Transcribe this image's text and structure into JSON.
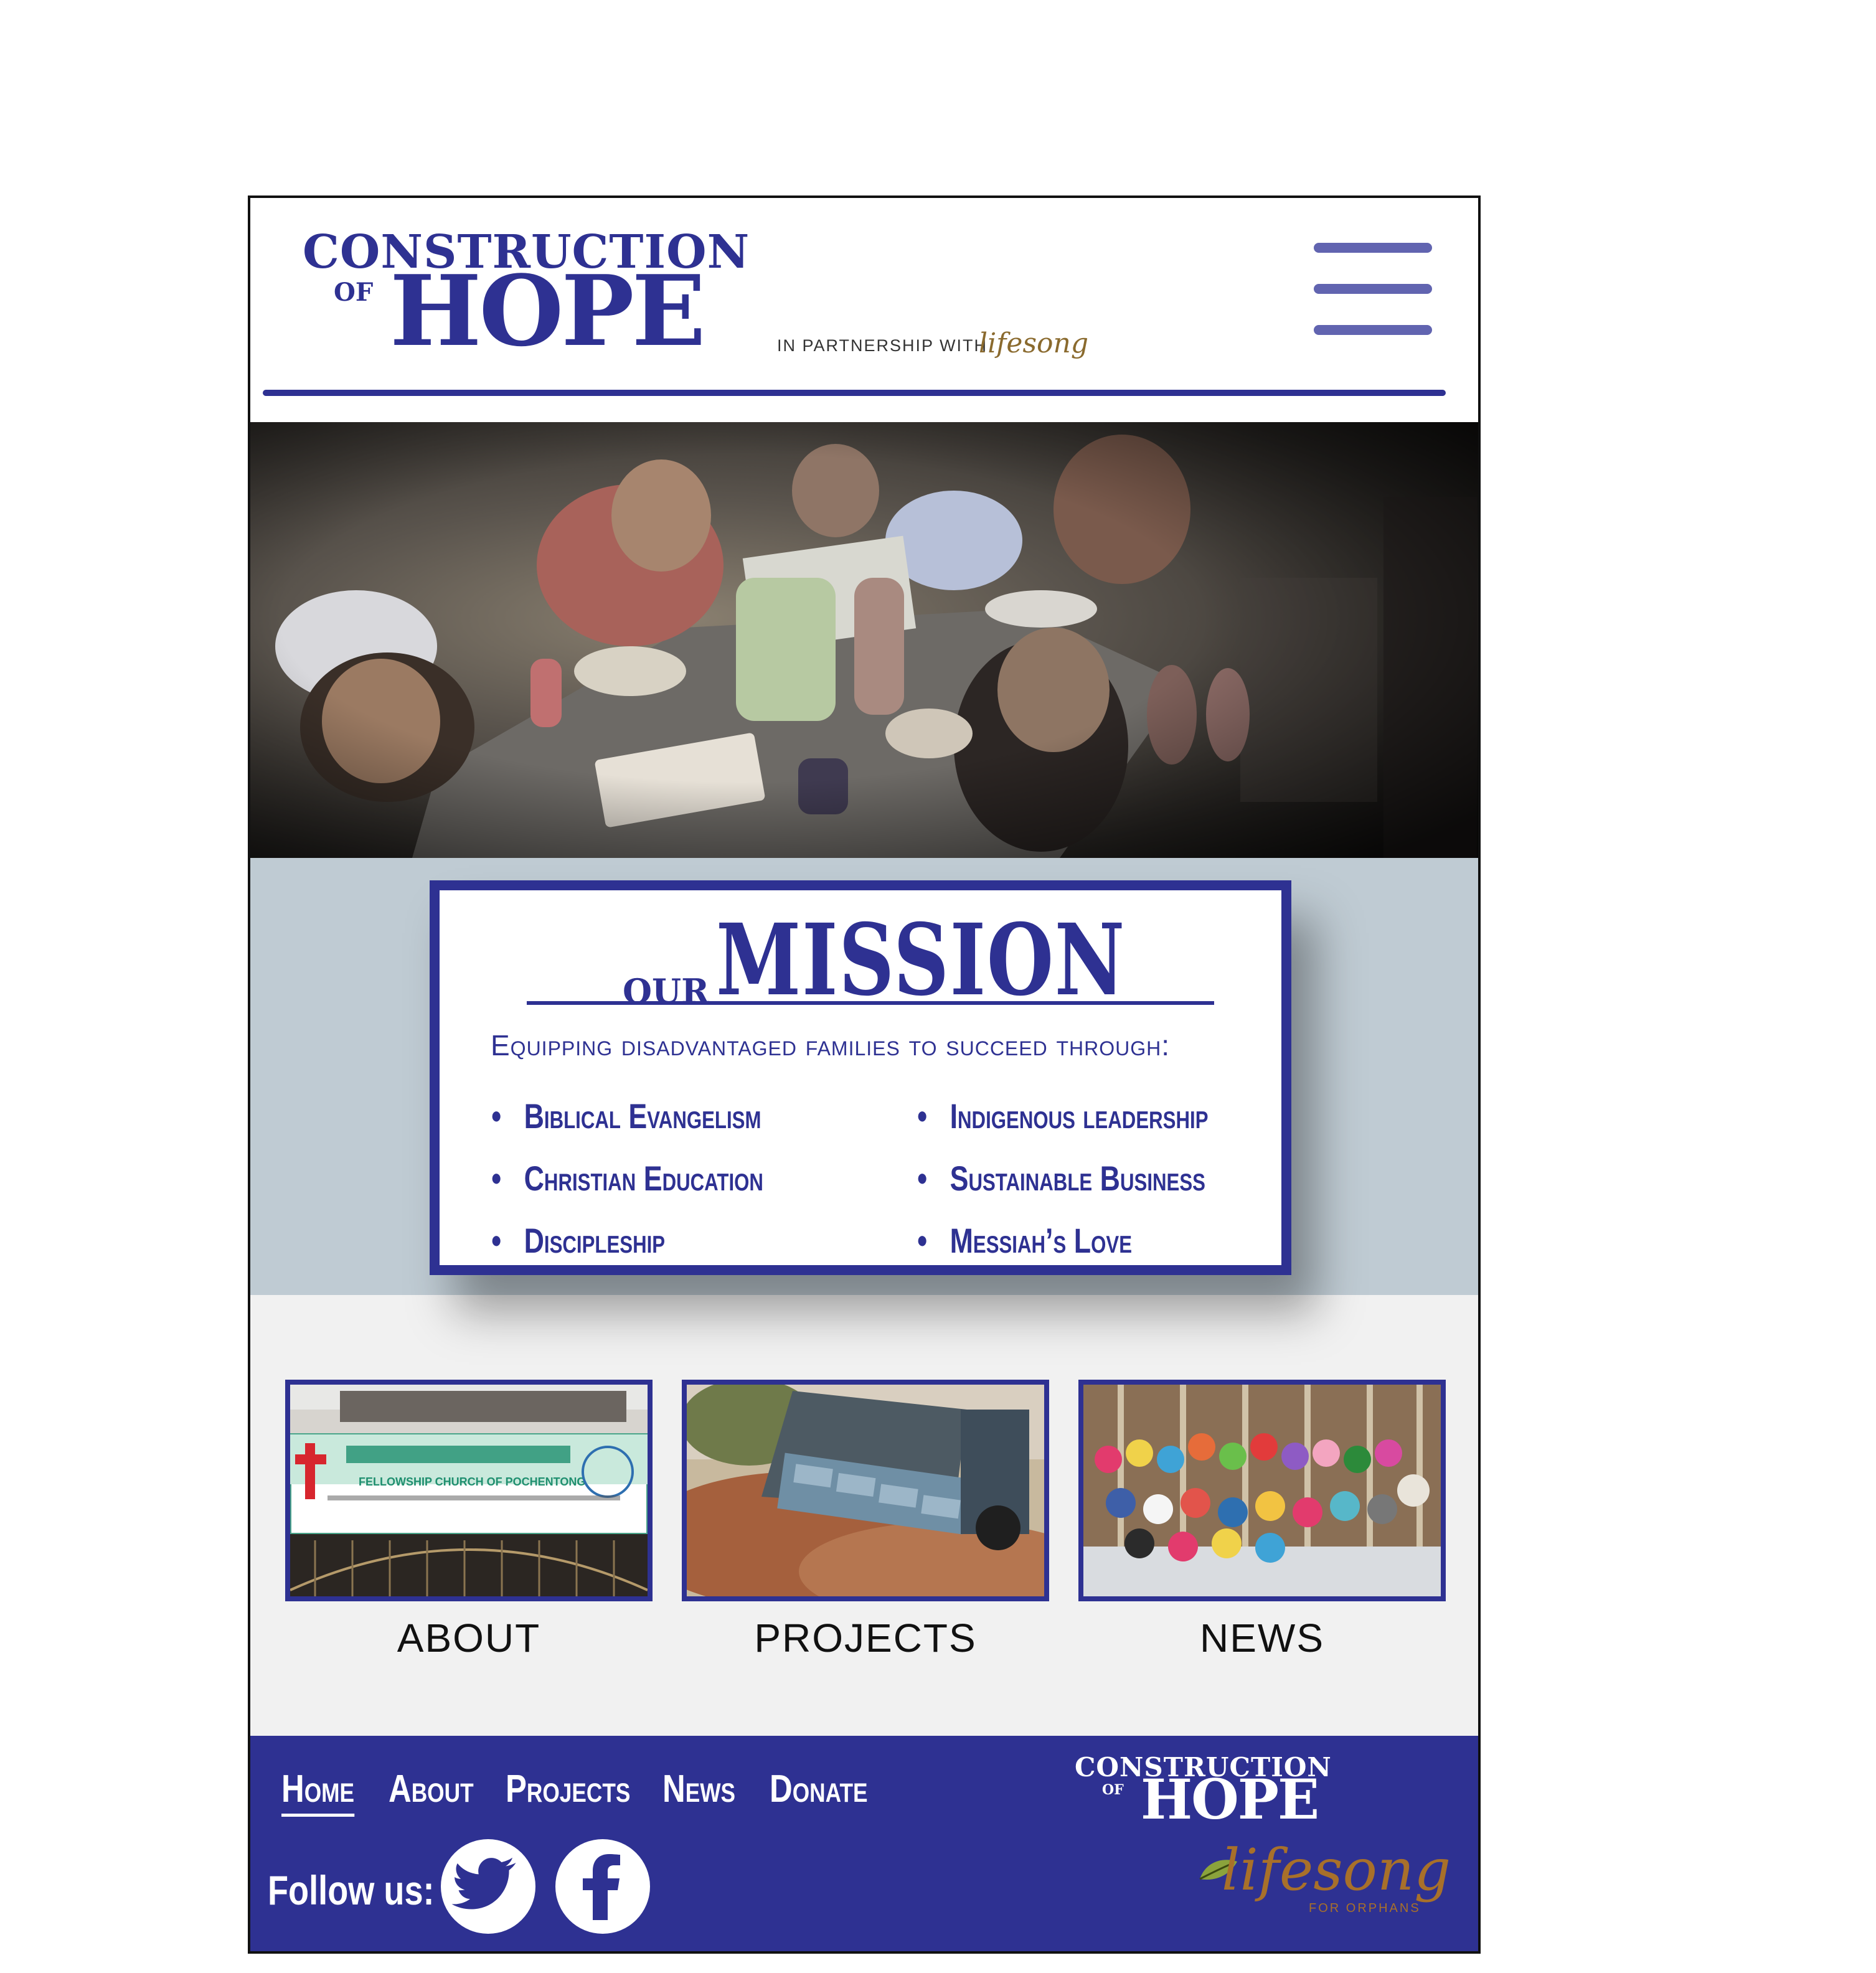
{
  "header": {
    "logo_line1": "CONSTRUCTION",
    "logo_of": "OF",
    "logo_hope": "HOPE",
    "partner_text": "IN PARTNERSHIP WITH",
    "partner_logo": "lifesong",
    "menu_icon": "hamburger-menu-icon"
  },
  "mission": {
    "our": "OUR",
    "title": "MISSION",
    "subtitle": "Equipping disadvantaged families to succeed through:",
    "left_items": [
      "Biblical Evangelism",
      "Christian Education",
      "Discipleship"
    ],
    "right_items": [
      "Indigenous leadership",
      "Sustainable Business",
      "Messiah’s Love"
    ]
  },
  "tiles": [
    {
      "label": "ABOUT",
      "sign_text": "FELLOWSHIP CHURCH OF POCHENTONG"
    },
    {
      "label": "PROJECTS"
    },
    {
      "label": "NEWS"
    }
  ],
  "footer": {
    "nav": [
      "Home",
      "About",
      "Projects",
      "News",
      "Donate"
    ],
    "active_nav": "Home",
    "follow_label": "Follow us:",
    "social": [
      "twitter-icon",
      "facebook-icon"
    ],
    "logo_line1": "CONSTRUCTION",
    "logo_of": "OF",
    "logo_hope": "HOPE",
    "partner_logo": "lifesong",
    "partner_tagline": "FOR ORPHANS"
  },
  "colors": {
    "brand_blue": "#2e3192",
    "menu_bar": "#6164b0",
    "mission_band": "#bfcbd3",
    "lower_band": "#f1f1f1",
    "lifesong_gold": "#a8702a"
  }
}
